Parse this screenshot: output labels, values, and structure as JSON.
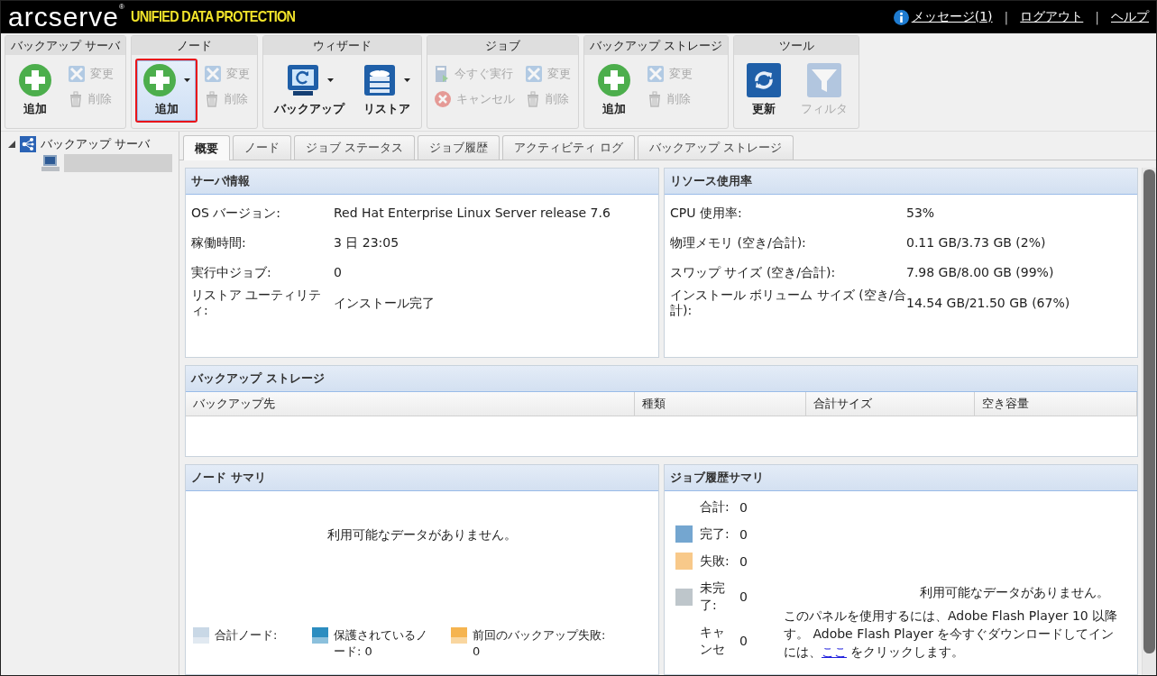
{
  "header": {
    "logo": "arcserve",
    "logo_mark": "®",
    "tagline": "UNIFIED DATA PROTECTION",
    "separator": "|",
    "links": [
      {
        "label": "メッセージ(1)",
        "kind": "info"
      },
      {
        "label": "ログアウト",
        "kind": "plain"
      },
      {
        "label": "ヘルプ",
        "kind": "plain"
      }
    ]
  },
  "toolbar": {
    "groups": [
      {
        "title": "バックアップ サーバ",
        "items": [
          {
            "kind": "add",
            "label": "追加",
            "disabled": false,
            "highlighted": false,
            "dropdown": false
          },
          {
            "kind": "edit",
            "label": "変更",
            "disabled": true,
            "highlighted": false,
            "dropdown": false
          },
          {
            "kind": "delete",
            "label": "削除",
            "disabled": true,
            "highlighted": false,
            "dropdown": false
          }
        ]
      },
      {
        "title": "ノード",
        "items": [
          {
            "kind": "add",
            "label": "追加",
            "disabled": false,
            "highlighted": true,
            "dropdown": true
          },
          {
            "kind": "edit",
            "label": "変更",
            "disabled": true,
            "highlighted": false,
            "dropdown": false
          },
          {
            "kind": "delete",
            "label": "削除",
            "disabled": true,
            "highlighted": false,
            "dropdown": false
          }
        ]
      },
      {
        "title": "ウィザード",
        "items": [
          {
            "kind": "backup",
            "label": "バックアップ",
            "disabled": false,
            "highlighted": false,
            "dropdown": true
          },
          {
            "kind": "restore",
            "label": "リストア",
            "disabled": false,
            "highlighted": false,
            "dropdown": true
          }
        ]
      },
      {
        "title": "ジョブ",
        "items": [
          {
            "kind": "run",
            "label": "今すぐ実行",
            "disabled": true,
            "highlighted": false,
            "dropdown": false
          },
          {
            "kind": "cancel",
            "label": "キャンセル",
            "disabled": true,
            "highlighted": false,
            "dropdown": false
          },
          {
            "kind": "edit",
            "label": "変更",
            "disabled": true,
            "highlighted": false,
            "dropdown": false
          },
          {
            "kind": "delete",
            "label": "削除",
            "disabled": true,
            "highlighted": false,
            "dropdown": false
          }
        ]
      },
      {
        "title": "バックアップ ストレージ",
        "items": [
          {
            "kind": "add",
            "label": "追加",
            "disabled": false,
            "highlighted": false,
            "dropdown": false
          },
          {
            "kind": "edit",
            "label": "変更",
            "disabled": true,
            "highlighted": false,
            "dropdown": false
          },
          {
            "kind": "delete",
            "label": "削除",
            "disabled": true,
            "highlighted": false,
            "dropdown": false
          }
        ]
      },
      {
        "title": "ツール",
        "items": [
          {
            "kind": "refresh",
            "label": "更新",
            "disabled": false,
            "highlighted": false,
            "dropdown": false
          },
          {
            "kind": "filter",
            "label": "フィルタ",
            "disabled": true,
            "highlighted": false,
            "dropdown": false
          }
        ]
      }
    ]
  },
  "tree": {
    "items": [
      {
        "label": "バックアップ サーバ",
        "expanded": true,
        "children": [
          {
            "kind": "redacted"
          }
        ]
      }
    ]
  },
  "tabs": [
    {
      "label": "概要",
      "selected": true
    },
    {
      "label": "ノード",
      "selected": false
    },
    {
      "label": "ジョブ ステータス",
      "selected": false
    },
    {
      "label": "ジョブ履歴",
      "selected": false
    },
    {
      "label": "アクティビティ ログ",
      "selected": false
    },
    {
      "label": "バックアップ ストレージ",
      "selected": false
    }
  ],
  "server_info": {
    "title": "サーバ情報",
    "rows": [
      {
        "label": "OS バージョン:",
        "value": "Red Hat Enterprise Linux Server release 7.6"
      },
      {
        "label": "稼働時間:",
        "value": "3 日 23:05"
      },
      {
        "label": "実行中ジョブ:",
        "value": "0"
      },
      {
        "label": "リストア ユーティリティ:",
        "value": "インストール完了"
      }
    ]
  },
  "resources": {
    "title": "リソース使用率",
    "rows": [
      {
        "label": "CPU 使用率:",
        "value": "53%"
      },
      {
        "label": "物理メモリ (空き/合計):",
        "value": "0.11 GB/3.73 GB (2%)"
      },
      {
        "label": "スワップ サイズ (空き/合計):",
        "value": "7.98 GB/8.00 GB (99%)"
      },
      {
        "label": "インストール ボリューム サイズ (空き/合計):",
        "value": "14.54 GB/21.50 GB (67%)"
      }
    ]
  },
  "backup_storage": {
    "title": "バックアップ ストレージ",
    "columns": [
      "バックアップ先",
      "種類",
      "合計サイズ",
      "空き容量"
    ]
  },
  "node_summary": {
    "title": "ノード サマリ",
    "message": "利用可能なデータがありません。",
    "legend": [
      {
        "label": "合計ノード:",
        "color": "#c9d8e6"
      },
      {
        "label": "保護されているノード: 0",
        "color": "#2c8dc0"
      },
      {
        "label": "前回のバックアップ失敗: 0",
        "color": "#f5b450"
      }
    ]
  },
  "job_history_summary": {
    "title": "ジョブ履歴サマリ",
    "legend": [
      {
        "label": "合計:",
        "value": "0"
      },
      {
        "label": "完了:",
        "value": "0",
        "color": "#74a6d0"
      },
      {
        "label": "失敗:",
        "value": "0",
        "color": "#f8c98a"
      },
      {
        "label": "未完了:",
        "value": "0",
        "color": "#bec6cb"
      },
      {
        "label": "キャンセ",
        "value": "0"
      }
    ],
    "message": "利用可能なデータがありません。",
    "notice": {
      "lines": [
        "このパネルを使用するには、Adobe Flash Player 10 以降",
        "す。 Adobe Flash Player を今すぐダウンロードしてイン"
      ],
      "before_link": "には、",
      "link": "ここ",
      "after_link": " をクリックします。"
    }
  }
}
